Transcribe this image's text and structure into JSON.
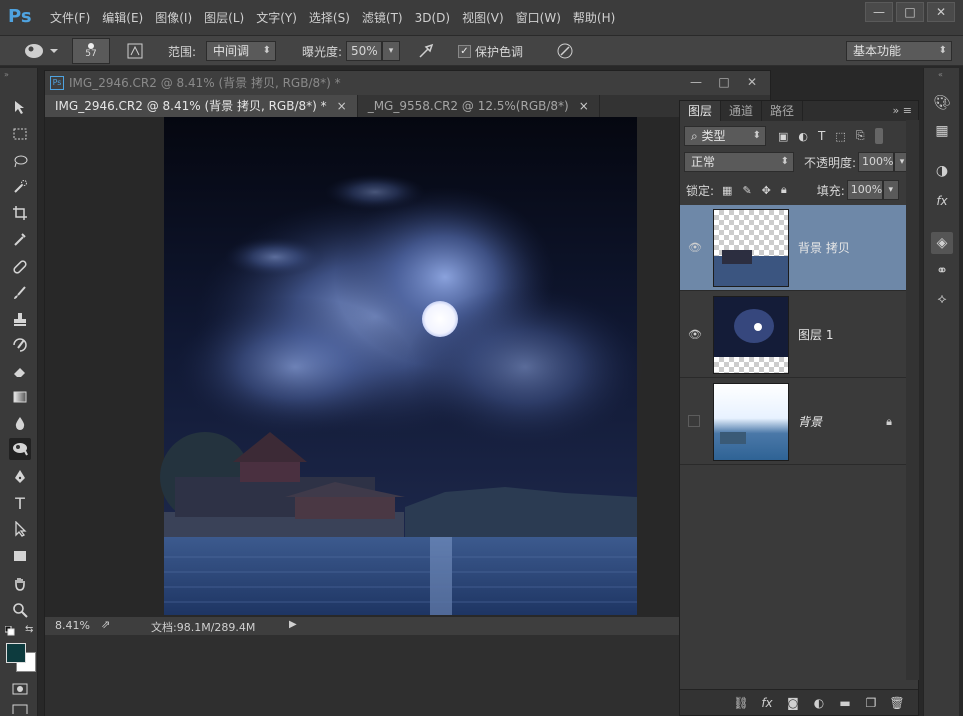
{
  "app": {
    "logo": "Ps"
  },
  "menu": [
    "文件(F)",
    "编辑(E)",
    "图像(I)",
    "图层(L)",
    "文字(Y)",
    "选择(S)",
    "滤镜(T)",
    "3D(D)",
    "视图(V)",
    "窗口(W)",
    "帮助(H)"
  ],
  "window_buttons": {
    "minimize": "—",
    "maximize": "□",
    "close": "✕"
  },
  "options": {
    "brush_size": "57",
    "range_label": "范围:",
    "range_value": "中间调",
    "exposure_label": "曝光度:",
    "exposure_value": "50%",
    "protect_tones_label": "保护色调",
    "workspace": "基本功能"
  },
  "document": {
    "window_title": "IMG_2946.CR2 @ 8.41% (背景 拷贝, RGB/8*) *",
    "tabs": [
      {
        "label": "IMG_2946.CR2 @ 8.41% (背景 拷贝, RGB/8*) *"
      },
      {
        "label": "_MG_9558.CR2 @ 12.5%(RGB/8*)"
      }
    ],
    "status_zoom": "8.41%",
    "status_doc": "文档:98.1M/289.4M"
  },
  "layers_panel": {
    "tabs": [
      "图层",
      "通道",
      "路径"
    ],
    "filter_kind": "类型",
    "blend_mode": "正常",
    "opacity_label": "不透明度:",
    "opacity_value": "100%",
    "lock_label": "锁定:",
    "fill_label": "填充:",
    "fill_value": "100%",
    "layers": [
      {
        "name": "背景 拷贝",
        "visible": true,
        "selected": true
      },
      {
        "name": "图层 1",
        "visible": true,
        "selected": false
      },
      {
        "name": "背景",
        "visible": false,
        "selected": false,
        "locked": true
      }
    ]
  },
  "colors": {
    "foreground": "#0d3b3e",
    "background": "#ffffff",
    "selection": "#6e88a8",
    "accent": "#4fa3e0"
  }
}
